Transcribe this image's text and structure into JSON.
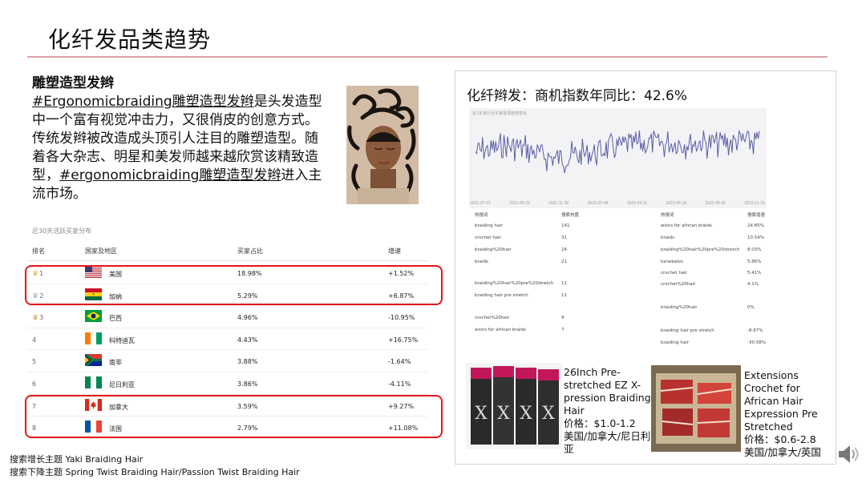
{
  "slide": {
    "title": "化纤发品类趋势"
  },
  "intro": {
    "heading": "雕塑造型发辫",
    "text_parts": [
      "#Ergonomicbraiding雕塑造型发辫",
      "是头发造型中一个富有视觉冲击力，又很俏皮的创意方式。传统发辫被改造成头顶引人注目的雕塑造型。随着各大杂志、明星和美发师越来越欣赏该精致造型，",
      "#ergonomicbraiding雕塑造型发辫",
      "进入主流市场。"
    ]
  },
  "ranking": {
    "caption": "近30天活跃买家分布",
    "headers": [
      "排名",
      "国家及地区",
      "买家占比",
      "增速"
    ],
    "rows": [
      {
        "rank": "1",
        "country": "美国",
        "share": "18.98%",
        "growth": "+1.52%",
        "flag": "us-flag-icon",
        "crown": "gold"
      },
      {
        "rank": "2",
        "country": "加纳",
        "share": "5.29%",
        "growth": "+6.87%",
        "flag": "ghana-flag-icon",
        "crown": "silver"
      },
      {
        "rank": "3",
        "country": "巴西",
        "share": "4.96%",
        "growth": "-10.95%",
        "flag": "brazil-flag-icon",
        "crown": "bronze"
      },
      {
        "rank": "4",
        "country": "科特迪瓦",
        "share": "4.43%",
        "growth": "+16.75%",
        "flag": "ivory-coast-flag-icon",
        "crown": ""
      },
      {
        "rank": "5",
        "country": "南非",
        "share": "3.88%",
        "growth": "-1.64%",
        "flag": "south-africa-flag-icon",
        "crown": ""
      },
      {
        "rank": "6",
        "country": "尼日利亚",
        "share": "3.86%",
        "growth": "-4.11%",
        "flag": "nigeria-flag-icon",
        "crown": ""
      },
      {
        "rank": "7",
        "country": "加拿大",
        "share": "3.59%",
        "growth": "+9.27%",
        "flag": "canada-flag-icon",
        "crown": ""
      },
      {
        "rank": "8",
        "country": "法国",
        "share": "2.79%",
        "growth": "+11.08%",
        "flag": "france-flag-icon",
        "crown": ""
      }
    ],
    "highlight_color": "#e4161b"
  },
  "notes": {
    "rising": "搜索增长主题 Yaki Braiding Hair",
    "falling": "搜索下降主题 Spring Twist Braiding Hair/Passion Twist Braiding Hair"
  },
  "card": {
    "title": "化纤辫发：商机指数年同比：42.6%",
    "chart_caption": "近1年该行业买家需求趋势变化",
    "x_ticks": [
      "2021-07-23",
      "2021-09-22",
      "2021-11-30",
      "2022-02-08",
      "2022-04-11",
      "2022-06-18",
      "2022-08-25",
      "2022-11-15"
    ],
    "line_color": "#5a5ea8",
    "kw_headers": [
      "热搜词",
      "搜索热度",
      "热搜词",
      "搜索增速"
    ],
    "kw_left": [
      {
        "term": "braiding hair",
        "value": "141"
      },
      {
        "term": "crochet hair",
        "value": "31"
      },
      {
        "term": "braiding%20hair",
        "value": "24"
      },
      {
        "term": "braids",
        "value": "21"
      },
      {
        "term": "braiding%20hair%20pre%20stretch",
        "value": "11"
      },
      {
        "term": "braiding hair pre stretch",
        "value": "11"
      },
      {
        "term": "crochet%20hair",
        "value": "9"
      },
      {
        "term": "wicks for african braids",
        "value": "7"
      }
    ],
    "kw_right": [
      {
        "term": "wicks for african braids",
        "value": "24.85%"
      },
      {
        "term": "braids",
        "value": "10.54%"
      },
      {
        "term": "braiding%20hair%20pre%20stretch",
        "value": "8.03%"
      },
      {
        "term": "kanekalon",
        "value": "5.86%"
      },
      {
        "term": "crochet hair",
        "value": "5.41%"
      },
      {
        "term": "crochet%20hair",
        "value": "4.1%"
      },
      {
        "term": "braiding%20hair",
        "value": "0%"
      },
      {
        "term": "braiding hair pre stretch",
        "value": "-8.67%"
      },
      {
        "term": "braiding hair",
        "value": "-30.58%"
      }
    ],
    "products": [
      {
        "name": "26Inch Pre-stretched EZ X-pression Braiding Hair",
        "price": "价格：$1.0-1.2",
        "markets": "美国/加拿大/尼日利亚"
      },
      {
        "name": "Extensions Crochet for African Hair Expression Pre Stretched",
        "price": "价格：$0.6-2.8",
        "markets": "美国/加拿大/英国"
      }
    ]
  }
}
